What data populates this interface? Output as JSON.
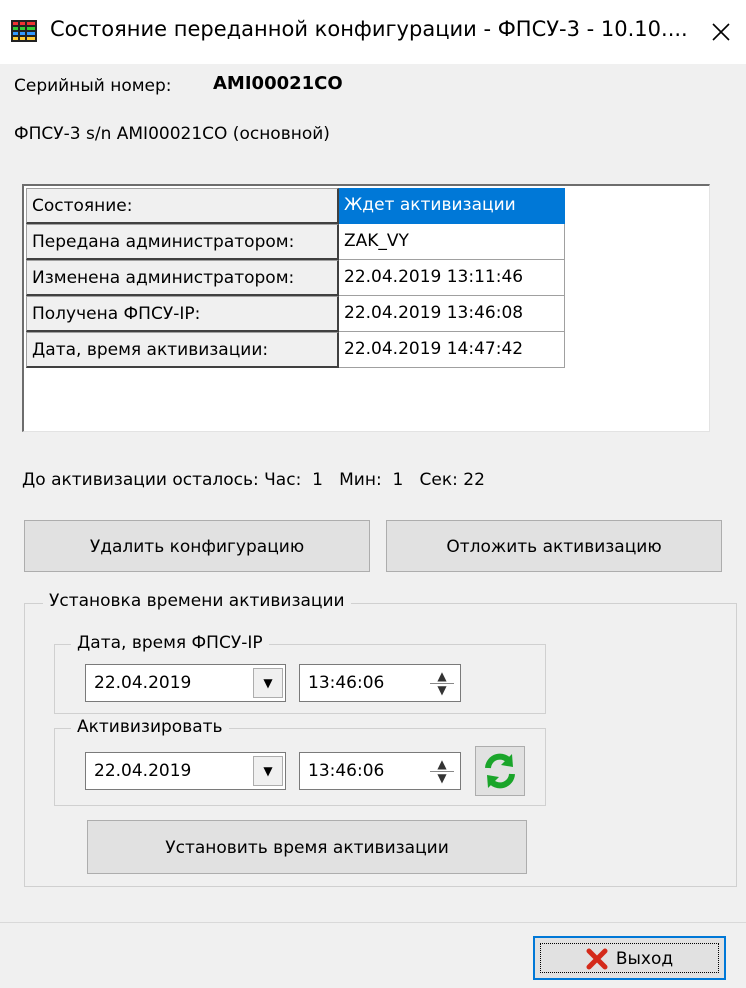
{
  "window": {
    "title": "Состояние переданной конфигурации - ФПСУ-3 - 10.10....",
    "icon": "app-grid-icon",
    "close_icon": "close-icon"
  },
  "serial": {
    "label": "Серийный номер:",
    "value": "AMI00021CO"
  },
  "device_line": "ФПСУ-3 s/n AMI00021CO (основной)",
  "status_table": {
    "rows": [
      {
        "key": "Состояние:",
        "value": "Ждет активизации",
        "selected": true
      },
      {
        "key": "Передана администратором:",
        "value": "ZAK_VY"
      },
      {
        "key": "Изменена администратором:",
        "value": "22.04.2019 13:11:46"
      },
      {
        "key": "Получена ФПСУ-IP:",
        "value": "22.04.2019 13:46:08"
      },
      {
        "key": "Дата, время активизации:",
        "value": "22.04.2019 14:47:42"
      }
    ],
    "selected_color": "#0078d7"
  },
  "countdown": "До активизации осталось: Час:  1   Мин:  1   Сек: 22",
  "buttons": {
    "delete_config": "Удалить конфигурацию",
    "postpone_activation": "Отложить активизацию",
    "set_activation_time": "Установить время активизации",
    "exit": "Выход"
  },
  "activation_group": {
    "title": "Установка времени активизации",
    "fpsu_group": {
      "title": "Дата, время ФПСУ-IP",
      "date": "22.04.2019",
      "time": "13:46:06"
    },
    "activate_group": {
      "title": "Активизировать",
      "date": "22.04.2019",
      "time": "13:46:06"
    }
  },
  "icons": {
    "dropdown": "▼",
    "spin_up": "▲",
    "spin_down": "▼",
    "refresh": "refresh-icon",
    "exit": "red-x-icon"
  },
  "colors": {
    "accent": "#0078d7",
    "refresh_green": "#1aa52a",
    "exit_red": "#d42a1a"
  }
}
